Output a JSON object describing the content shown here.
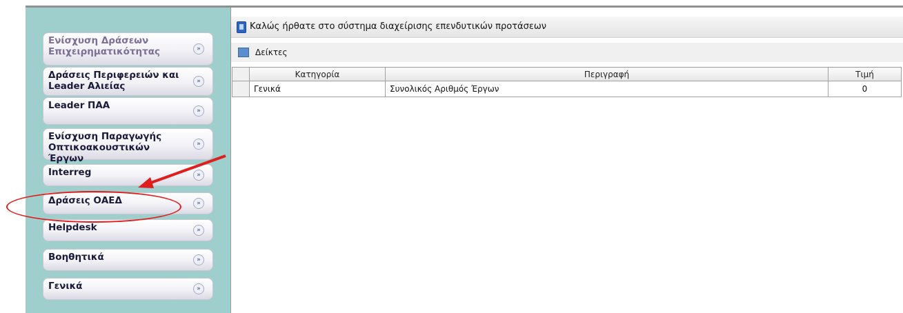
{
  "app": {
    "welcome_title": "Καλώς ήρθατε στο σύστημα διαχείρισης επενδυτικών προτάσεων",
    "section_title": "Δείκτες"
  },
  "sidebar": {
    "items": [
      {
        "label": "Ενίσχυση Δράσεων Επιχειρηματικότητας"
      },
      {
        "label": "Δράσεις Περιφερειών και Leader Αλιείας"
      },
      {
        "label": "Leader ΠΑΑ"
      },
      {
        "label": "Ενίσχυση Παραγωγής Οπτικοακουστικών Έργων"
      },
      {
        "label": "Interreg"
      },
      {
        "label": "Δράσεις ΟΑΕΔ"
      },
      {
        "label": "Helpdesk"
      },
      {
        "label": "Βοηθητικά"
      },
      {
        "label": "Γενικά"
      }
    ]
  },
  "table": {
    "columns": [
      "Κατηγορία",
      "Περιγραφή",
      "Τιμή"
    ],
    "rows": [
      {
        "category": "Γενικά",
        "description": "Συνολικός Αριθμός Έργων",
        "value": "0"
      }
    ]
  },
  "icons": {
    "expand": "double-chevron-down-icon",
    "welcome": "app-icon",
    "indicators": "chart-icon"
  },
  "colors": {
    "sidebar_bg": "#9ecfcc",
    "annotation": "#e01e1e",
    "muted_label": "#7a6f95"
  }
}
